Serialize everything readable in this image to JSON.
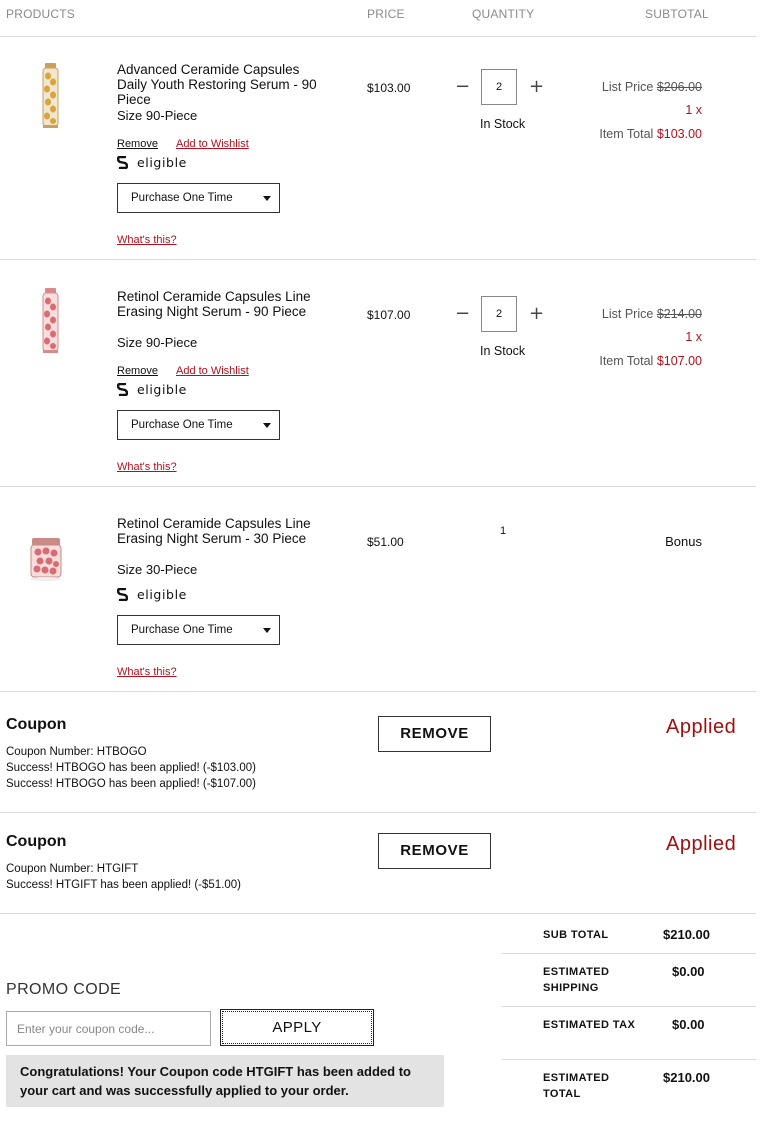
{
  "header": {
    "products": "PRODUCTS",
    "price": "PRICE",
    "quantity": "QUANTITY",
    "subtotal": "SUBTOTAL"
  },
  "items": [
    {
      "name": "Advanced Ceramide Capsules Daily Youth Restoring Serum - 90 Piece",
      "size": "Size 90-Piece",
      "remove": "Remove",
      "wishlist": "Add to Wishlist",
      "eligible": "eligible",
      "purchase": "Purchase One Time",
      "whats_this": "What's this?",
      "price": "$103.00",
      "qty": "2",
      "stock": "In Stock",
      "list_label": "List Price",
      "list_price": "$206.00",
      "multiplier": "1 x",
      "total_label": "Item Total",
      "total": "$103.00"
    },
    {
      "name": "Retinol Ceramide Capsules Line Erasing Night Serum - 90 Piece",
      "size": "Size 90-Piece",
      "remove": "Remove",
      "wishlist": "Add to Wishlist",
      "eligible": "eligible",
      "purchase": "Purchase One Time",
      "whats_this": "What's this?",
      "price": "$107.00",
      "qty": "2",
      "stock": "In Stock",
      "list_label": "List Price",
      "list_price": "$214.00",
      "multiplier": "1 x",
      "total_label": "Item Total",
      "total": "$107.00"
    },
    {
      "name": "Retinol Ceramide Capsules Line Erasing Night Serum - 30 Piece",
      "size": "Size 30-Piece",
      "eligible": "eligible",
      "purchase": "Purchase One Time",
      "whats_this": "What's this?",
      "price": "$51.00",
      "qty": "1",
      "subtotal": "Bonus"
    }
  ],
  "coupons": [
    {
      "title": "Coupon",
      "lines": [
        "Coupon Number: HTBOGO",
        "Success! HTBOGO has been applied! (-$103.00)",
        "Success! HTBOGO has been applied! (-$107.00)"
      ],
      "remove": "REMOVE",
      "status": "Applied"
    },
    {
      "title": "Coupon",
      "lines": [
        "Coupon Number: HTGIFT",
        "Success! HTGIFT has been applied! (-$51.00)"
      ],
      "remove": "REMOVE",
      "status": "Applied"
    }
  ],
  "promo": {
    "label": "PROMO CODE",
    "placeholder": "Enter your coupon code...",
    "apply": "APPLY",
    "message": "Congratulations! Your Coupon code HTGIFT has been added to your cart and was successfully applied to your order."
  },
  "totals": [
    {
      "label": "SUB TOTAL",
      "value": "$210.00"
    },
    {
      "label": "ESTIMATED SHIPPING",
      "value": "$0.00"
    },
    {
      "label": "ESTIMATED TAX",
      "value": "$0.00"
    },
    {
      "label": "ESTIMATED TOTAL",
      "value": "$210.00"
    }
  ],
  "colors": {
    "accent_red": "#b0111e",
    "applied_red": "#a00f0f",
    "rule": "#d9d9d9",
    "message_bg": "#e3e3e3"
  },
  "icons": [
    "serum-bottle-gold",
    "serum-bottle-pink",
    "serum-jar-pink",
    "shoprunner-icon",
    "caret-down-icon",
    "minus-icon",
    "plus-icon"
  ]
}
